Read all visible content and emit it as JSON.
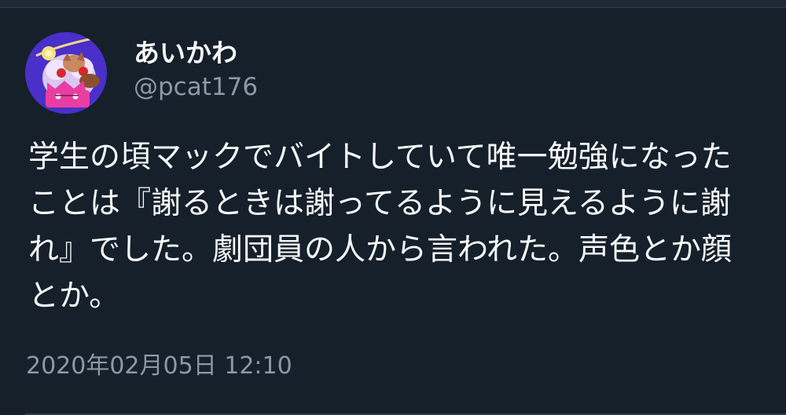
{
  "tweet": {
    "author": {
      "display_name": "あいかわ",
      "handle": "@pcat176",
      "avatar_icon": "profile-avatar"
    },
    "text_lines": [
      "学生の頃マックでバイトしていて唯一勉強になった",
      "ことは『謝るときは謝ってるように見えるように謝",
      "れ』でした。劇団員の人から言われた。声色とか顔",
      "とか。"
    ],
    "timestamp": "2020年02月05日 12:10"
  },
  "theme": {
    "background": "#15202b",
    "text_primary": "#f7f9f9",
    "text_secondary": "#8b98a5",
    "avatar_bg": "#4a2fc9",
    "avatar_accent": "#e83ea1"
  }
}
